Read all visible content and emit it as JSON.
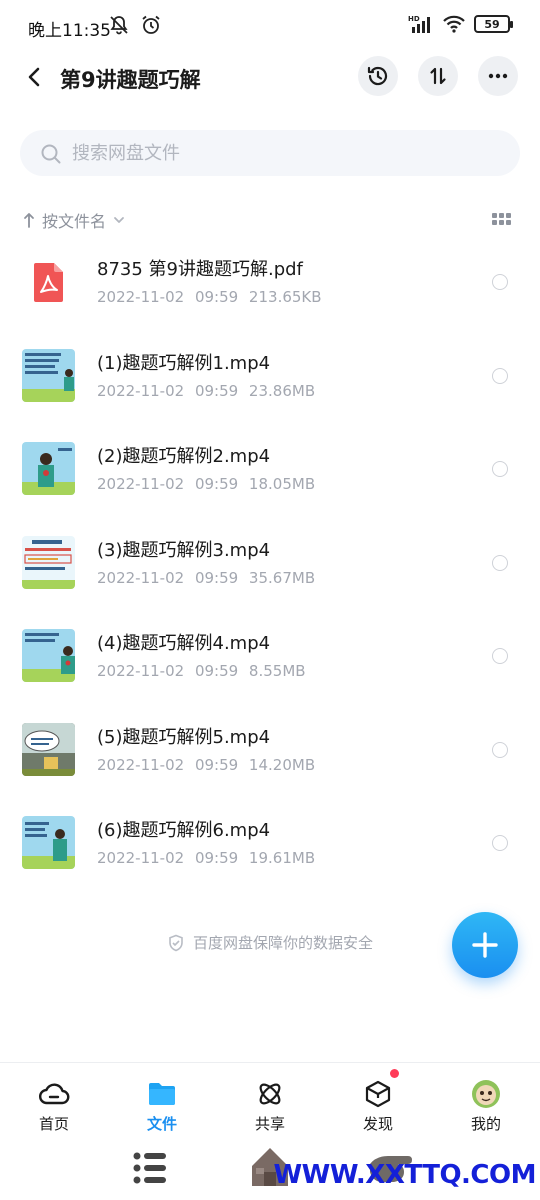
{
  "status": {
    "time": "晚上11:35",
    "battery": "59"
  },
  "header": {
    "title": "第9讲趣题巧解"
  },
  "search": {
    "placeholder": "搜索网盘文件"
  },
  "sort": {
    "label": "按文件名"
  },
  "files": [
    {
      "name": "8735  第9讲趣题巧解.pdf",
      "meta": "2022-11-02  09:59  213.65KB",
      "type": "pdf"
    },
    {
      "name": "(1)趣题巧解例1.mp4",
      "meta": "2022-11-02  09:59  23.86MB",
      "type": "video"
    },
    {
      "name": "(2)趣题巧解例2.mp4",
      "meta": "2022-11-02  09:59  18.05MB",
      "type": "video"
    },
    {
      "name": "(3)趣题巧解例3.mp4",
      "meta": "2022-11-02  09:59  35.67MB",
      "type": "video"
    },
    {
      "name": "(4)趣题巧解例4.mp4",
      "meta": "2022-11-02  09:59  8.55MB",
      "type": "video"
    },
    {
      "name": "(5)趣题巧解例5.mp4",
      "meta": "2022-11-02  09:59  14.20MB",
      "type": "video"
    },
    {
      "name": "(6)趣题巧解例6.mp4",
      "meta": "2022-11-02  09:59  19.61MB",
      "type": "video"
    }
  ],
  "footer_note": "百度网盘保障你的数据安全",
  "nav": {
    "items": [
      {
        "label": "首页",
        "icon": "cloud-icon"
      },
      {
        "label": "文件",
        "icon": "folder-icon",
        "active": true
      },
      {
        "label": "共享",
        "icon": "atom-icon"
      },
      {
        "label": "发现",
        "icon": "cube-icon",
        "badge": true
      },
      {
        "label": "我的",
        "icon": "avatar-icon"
      }
    ]
  },
  "watermark": "WWW.XXTTQ.COM",
  "colors": {
    "accent": "#1a8ff0",
    "badge": "#ff3b58",
    "pdf": "#f05555"
  }
}
